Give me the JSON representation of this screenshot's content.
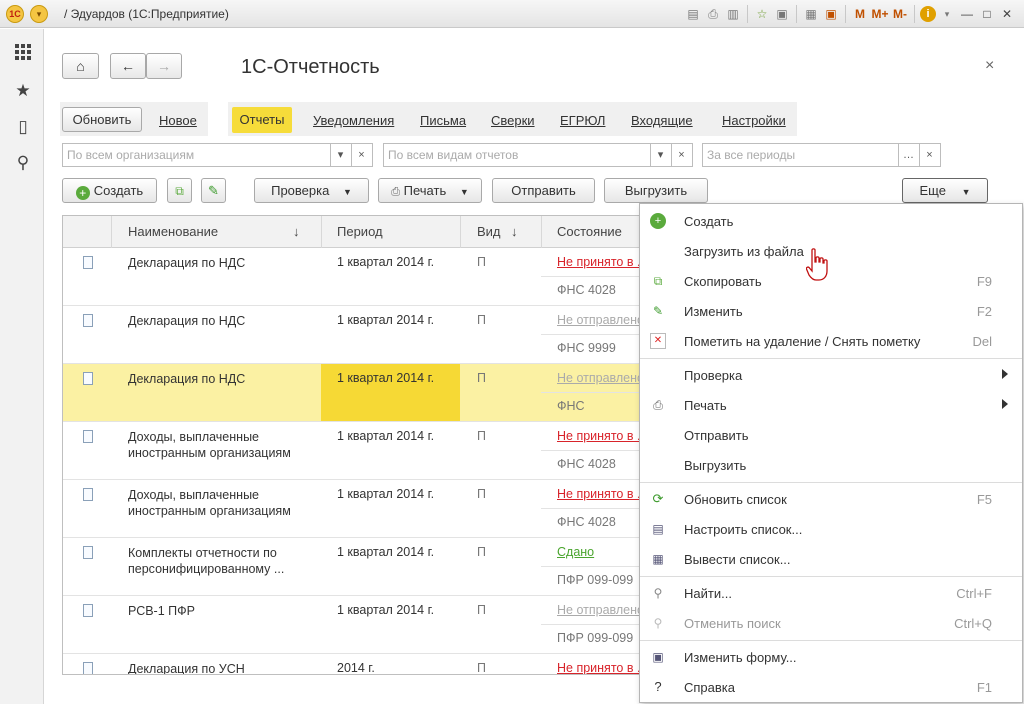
{
  "window": {
    "title": "/ Эдуардов  (1С:Предприятие)",
    "logo": "1С",
    "toolbar_icons": [
      "save-icon",
      "print-icon",
      "preview-icon",
      "favorite-icon",
      "history-icon",
      "calc-icon",
      "calendar-icon"
    ],
    "memory": {
      "m": "M",
      "mplus": "M+",
      "mminus": "M-"
    },
    "info_icon": "i",
    "controls": {
      "minimize": "—",
      "maximize": "□",
      "close": "✕"
    }
  },
  "leftbar": {
    "icons": [
      "apps-icon",
      "favorites-star-icon",
      "history-icon",
      "search-icon"
    ]
  },
  "page": {
    "title": "1С-Отчетность",
    "close": "×"
  },
  "nav": {
    "home": "⌂",
    "back": "←",
    "forward": "→"
  },
  "command_bar": {
    "refresh": "Обновить",
    "new": "Новое",
    "tabs": [
      "Отчеты",
      "Уведомления",
      "Письма",
      "Сверки",
      "ЕГРЮЛ",
      "Входящие",
      "Настройки"
    ],
    "active_tab": "Отчеты"
  },
  "filters": [
    {
      "placeholder": "По всем организациям"
    },
    {
      "placeholder": "По всем видам отчетов"
    },
    {
      "placeholder": "За все периоды"
    }
  ],
  "toolbar": {
    "create": "Создать",
    "check": "Проверка",
    "print": "Печать",
    "send": "Отправить",
    "export": "Выгрузить",
    "more": "Еще"
  },
  "table": {
    "columns": [
      "Наименование",
      "Период",
      "Вид",
      "Состояние"
    ],
    "sort_arrow": "↓",
    "rows": [
      {
        "name": "Декларация по НДС",
        "period": "1 квартал 2014 г.",
        "kind": "П",
        "status": "Не принято в ...",
        "status_color": "red",
        "agency": "ФНС 4028",
        "selected": false
      },
      {
        "name": "Декларация по НДС",
        "period": "1 квартал 2014 г.",
        "kind": "П",
        "status": "Не отправлено",
        "status_color": "gray",
        "agency": "ФНС 9999",
        "selected": false
      },
      {
        "name": "Декларация по НДС",
        "period": "1 квартал 2014 г.",
        "kind": "П",
        "status": "Не отправлено",
        "status_color": "gray",
        "agency": "ФНС",
        "selected": true
      },
      {
        "name": "Доходы, выплаченные иностранным организациям",
        "period": "1 квартал 2014 г.",
        "kind": "П",
        "status": "Не принято в ...",
        "status_color": "red",
        "agency": "ФНС 4028",
        "selected": false
      },
      {
        "name": "Доходы, выплаченные иностранным организациям",
        "period": "1 квартал 2014 г.",
        "kind": "П",
        "status": "Не принято в ...",
        "status_color": "red",
        "agency": "ФНС 4028",
        "selected": false
      },
      {
        "name": "Комплекты отчетности по персонифицированному ...",
        "period": "1 квартал 2014 г.",
        "kind": "П",
        "status": "Сдано",
        "status_color": "green",
        "agency": "ПФР 099-099",
        "selected": false
      },
      {
        "name": "РСВ-1 ПФР",
        "period": "1 квартал 2014 г.",
        "kind": "П",
        "status": "Не отправлено",
        "status_color": "gray",
        "agency": "ПФР 099-099",
        "selected": false
      },
      {
        "name": "Декларация по УСН",
        "period": "2014 г.",
        "kind": "П",
        "status": "Не принято в ...",
        "status_color": "red",
        "agency": "",
        "selected": false
      }
    ]
  },
  "menu": {
    "items": [
      {
        "label": "Создать",
        "icon": "plus-circle-icon",
        "shortcut": "",
        "submenu": false,
        "disabled": false
      },
      {
        "label": "Загрузить из файла",
        "icon": "",
        "shortcut": "",
        "submenu": false,
        "disabled": false
      },
      {
        "label": "Скопировать",
        "icon": "copy-icon",
        "shortcut": "F9",
        "submenu": false,
        "disabled": false
      },
      {
        "label": "Изменить",
        "icon": "pencil-icon",
        "shortcut": "F2",
        "submenu": false,
        "disabled": false
      },
      {
        "label": "Пометить на удаление / Снять пометку",
        "icon": "delete-mark-icon",
        "shortcut": "Del",
        "submenu": false,
        "disabled": false
      },
      {
        "label": "Проверка",
        "icon": "",
        "shortcut": "",
        "submenu": true,
        "disabled": false
      },
      {
        "label": "Печать",
        "icon": "printer-icon",
        "shortcut": "",
        "submenu": true,
        "disabled": false
      },
      {
        "label": "Отправить",
        "icon": "",
        "shortcut": "",
        "submenu": false,
        "disabled": false
      },
      {
        "label": "Выгрузить",
        "icon": "",
        "shortcut": "",
        "submenu": false,
        "disabled": false
      },
      {
        "label": "Обновить список",
        "icon": "refresh-icon",
        "shortcut": "F5",
        "submenu": false,
        "disabled": false
      },
      {
        "label": "Настроить список...",
        "icon": "list-settings-icon",
        "shortcut": "",
        "submenu": false,
        "disabled": false
      },
      {
        "label": "Вывести список...",
        "icon": "export-list-icon",
        "shortcut": "",
        "submenu": false,
        "disabled": false
      },
      {
        "label": "Найти...",
        "icon": "search-icon",
        "shortcut": "Ctrl+F",
        "submenu": false,
        "disabled": false
      },
      {
        "label": "Отменить поиск",
        "icon": "cancel-search-icon",
        "shortcut": "Ctrl+Q",
        "submenu": false,
        "disabled": true
      },
      {
        "label": "Изменить форму...",
        "icon": "form-settings-icon",
        "shortcut": "",
        "submenu": false,
        "disabled": false
      },
      {
        "label": "Справка",
        "icon": "help-icon",
        "shortcut": "F1",
        "submenu": false,
        "disabled": false
      }
    ]
  }
}
